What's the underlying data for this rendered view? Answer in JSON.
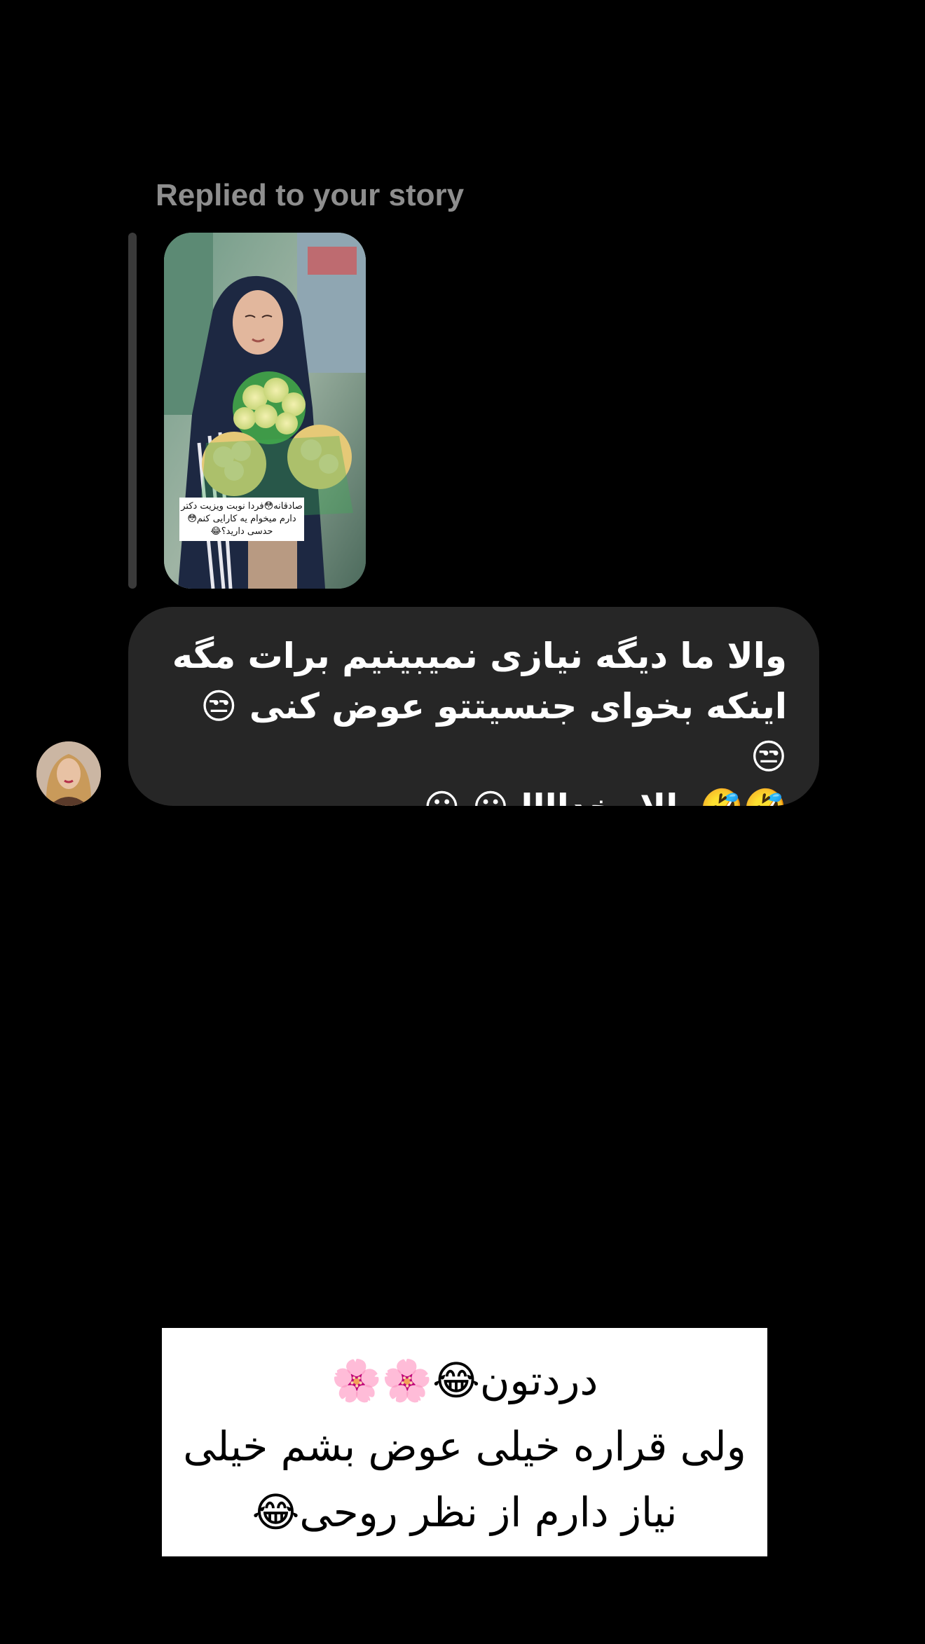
{
  "story_reply": {
    "label": "Replied to your story",
    "thumbnail_caption": "صادقانه😳فردا نوبت ویزیت دکتر\nدارم میخوام یه کارایی کنم😳\nحدسی دارید؟😂"
  },
  "message": {
    "text": "والا ما دیگه نیازی نمیبینیم برات مگه\nاینکه بخوای جنسیتتو عوض کنی 😒 😒\n🤣🤣والا بخداااا 😐 😐"
  },
  "overlay_caption": {
    "text": "دردتون😂🌸🌸\nولی قراره خیلی عوض بشم خیلی\nنیاز دارم از نظر روحی😂"
  },
  "colors": {
    "background": "#000000",
    "bubble": "#262626",
    "label": "#8e8e8e"
  }
}
